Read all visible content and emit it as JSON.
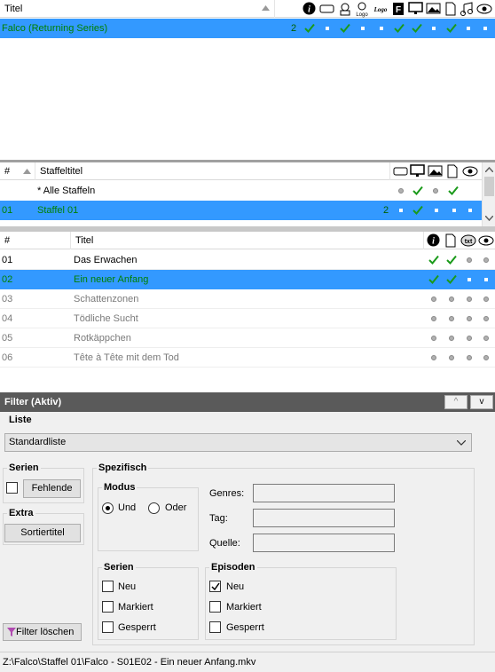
{
  "series_pane": {
    "header": {
      "title_label": "Titel"
    },
    "rows": [
      {
        "title": "Falco (Returning Series)",
        "count": "2"
      }
    ]
  },
  "season_pane": {
    "header": {
      "num_label": "#",
      "title_label": "Staffeltitel"
    },
    "rows": [
      {
        "num": "",
        "title": "* Alle Staffeln",
        "count": ""
      },
      {
        "num": "01",
        "title": "Staffel 01",
        "count": "2"
      }
    ]
  },
  "episode_pane": {
    "header": {
      "num_label": "#",
      "title_label": "Titel"
    },
    "rows": [
      {
        "num": "01",
        "title": "Das Erwachen"
      },
      {
        "num": "02",
        "title": "Ein neuer Anfang"
      },
      {
        "num": "03",
        "title": "Schattenzonen"
      },
      {
        "num": "04",
        "title": "Tödliche Sucht"
      },
      {
        "num": "05",
        "title": "Rotkäppchen"
      },
      {
        "num": "06",
        "title": "Tête à Tête mit dem Tod"
      }
    ]
  },
  "filter": {
    "title": "Filter (Aktiv)",
    "up_label": "^",
    "down_label": "v",
    "liste_label": "Liste",
    "liste_value": "Standardliste",
    "serien_label": "Serien",
    "fehlende_label": "Fehlende",
    "extra_label": "Extra",
    "sortiertitel_label": "Sortiertitel",
    "spezifisch_label": "Spezifisch",
    "modus_label": "Modus",
    "und_label": "Und",
    "oder_label": "Oder",
    "genres_label": "Genres:",
    "tag_label": "Tag:",
    "quelle_label": "Quelle:",
    "serien_group_label": "Serien",
    "episoden_group_label": "Episoden",
    "neu_label": "Neu",
    "markiert_label": "Markiert",
    "gesperrt_label": "Gesperrt",
    "clear_label": "Filter löschen"
  },
  "status": {
    "path": "Z:\\Falco\\Staffel 01\\Falco - S01E02 - Ein neuer Anfang.mkv"
  },
  "colors": {
    "selection": "#3399ff",
    "green_text": "#008000",
    "check": "#1a9a1a",
    "filter_bar": "#5a5a5a"
  }
}
